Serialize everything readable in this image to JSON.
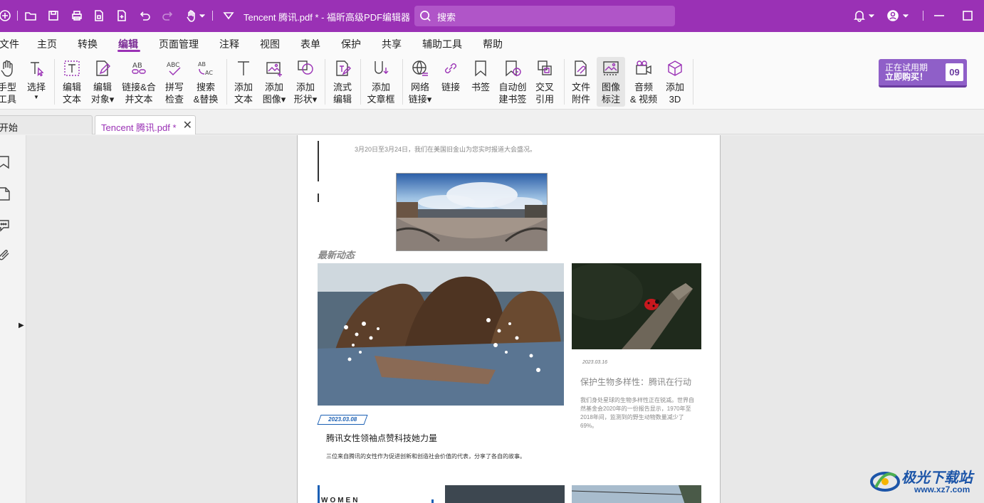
{
  "titlebar": {
    "doc_title": "Tencent 腾讯.pdf * - 福昕高级PDF编辑器",
    "search_placeholder": "搜索"
  },
  "menu": [
    "文件",
    "主页",
    "转换",
    "编辑",
    "页面管理",
    "注释",
    "视图",
    "表单",
    "保护",
    "共享",
    "辅助工具",
    "帮助"
  ],
  "active_menu": "编辑",
  "ribbon": {
    "hand": "手型\n工具",
    "select": "选择",
    "edit_text": "编辑\n文本",
    "edit_object": "编辑\n对象▾",
    "link_merge": "链接&合\n并文本",
    "spell": "拼写\n检查",
    "find_replace": "搜索\n&替换",
    "add_text": "添加\n文本",
    "add_image": "添加\n图像▾",
    "add_shape": "添加\n形状▾",
    "flow_edit": "流式\n编辑",
    "add_article": "添加\n文章框",
    "web_link": "网络\n链接▾",
    "link": "链接",
    "bookmark": "书签",
    "auto_bookmark": "自动创\n建书签",
    "cross_ref": "交叉\n引用",
    "file_attach": "文件\n附件",
    "image_annot": "图像\n标注",
    "audio_video": "音频\n& 视频",
    "add_3d": "添加\n3D"
  },
  "trial": {
    "line1": "正在试用期",
    "line2": "立即购买！",
    "days": "09"
  },
  "tabs": {
    "start": "开始",
    "doc": "Tencent 腾讯.pdf *",
    "close": "✕"
  },
  "page": {
    "caption": "3月20日至3月24日，我们在美国旧金山为您实时报道大会盛况。",
    "section_title": "最新动态",
    "date1": "2023.03.08",
    "headline1": "腾讯女性领袖点赞科技她力量",
    "body1": "三位来自腾讯的女性作为促进创新和创造社会价值的代表，分享了各自的故事。",
    "date2": "2023.03.16",
    "headline2": "保护生物多样性：腾讯在行动",
    "body2": "我们身处星球的生物多样性正在锐减。世界自然基金会2020年的一份报告显示，1970年至2018年间，监测到的野生动物数量减少了69%。",
    "women": "WOMEN"
  },
  "watermark": {
    "name": "极光下载站",
    "url": "www.xz7.com"
  },
  "colors": {
    "accent": "#9a31b5",
    "trial_bg": "#8f5fc8",
    "link_blue": "#1a5fb4"
  }
}
